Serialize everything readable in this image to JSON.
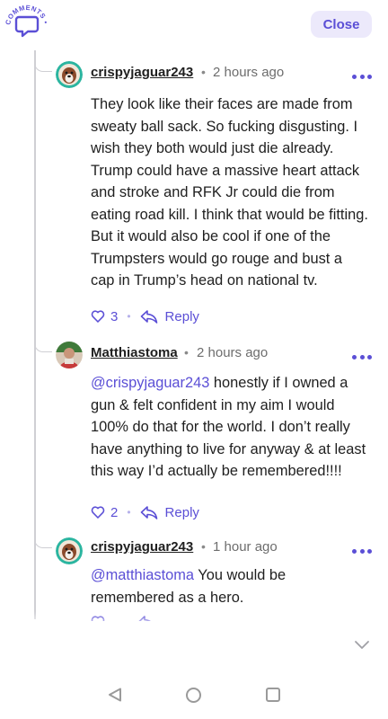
{
  "header": {
    "logo_text": "COMMENTS",
    "close_label": "Close"
  },
  "colors": {
    "accent": "#5b4fd6",
    "close_bg": "#ece9fb",
    "thread_line": "#cfcfd4"
  },
  "comments": [
    {
      "username": "crispyjaguar243",
      "time": "2 hours ago",
      "mention": "",
      "text": "They look like their faces are made from sweaty ball sack. So fucking disgusting. I wish they both would just die already. Trump could have a massive heart attack and stroke and RFK Jr could die from eating road kill. I think that would be fitting. But it would also be cool if one of the Trumpsters would go rouge and bust a cap in Trump’s head on national tv.",
      "likes": "3",
      "reply_label": "Reply"
    },
    {
      "username": "Matthiastoma",
      "time": "2 hours ago",
      "mention": "@crispyjaguar243",
      "text": " honestly if I owned a gun & felt confident in my aim I would 100% do that for the world. I don’t really have anything to live for anyway & at least this way I’d actually be remembered!!!!",
      "likes": "2",
      "reply_label": "Reply"
    },
    {
      "username": "crispyjaguar243",
      "time": "1 hour ago",
      "mention": "@matthiastoma",
      "text": " You would be remembered as a hero.",
      "likes": "",
      "reply_label": ""
    }
  ],
  "icons": {
    "logo": "comments-bubble-icon",
    "more": "more-dots-icon",
    "like": "heart-icon",
    "reply": "reply-arrow-icon",
    "scroll": "chevron-down-icon",
    "nav": [
      "back-triangle-icon",
      "home-circle-icon",
      "recents-square-icon"
    ]
  }
}
